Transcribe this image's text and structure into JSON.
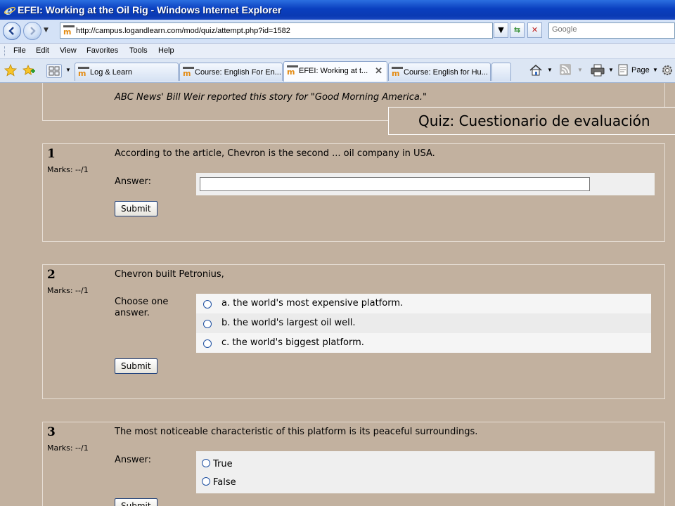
{
  "window": {
    "title": "EFEI: Working at the Oil Rig - Windows Internet Explorer"
  },
  "address": {
    "url": "http://campus.logandlearn.com/mod/quiz/attempt.php?id=1582",
    "search_placeholder": "Google"
  },
  "menu": [
    "File",
    "Edit",
    "View",
    "Favorites",
    "Tools",
    "Help"
  ],
  "tabs": [
    {
      "label": "Log & Learn"
    },
    {
      "label": "Course: English For En..."
    },
    {
      "label": "EFEI: Working at t..."
    },
    {
      "label": "Course: English for Hu..."
    }
  ],
  "commands": {
    "page": "Page"
  },
  "page": {
    "credit": "ABC News' Bill Weir reported this story for \"Good Morning America.\"",
    "overlay_title": "Quiz: Cuestionario de evaluación",
    "questions": [
      {
        "number": "1",
        "marks": "Marks: --/1",
        "text": "According to the article, Chevron is the second ... oil company in USA.",
        "answer_label": "Answer:",
        "answer_value": "",
        "submit": "Submit"
      },
      {
        "number": "2",
        "marks": "Marks: --/1",
        "text": "Chevron built Petronius,",
        "answer_label_1": "Choose one",
        "answer_label_2": "answer.",
        "options": [
          "a. the world's most expensive platform.",
          "b. the world's largest oil well.",
          "c. the world's biggest platform."
        ],
        "submit": "Submit"
      },
      {
        "number": "3",
        "marks": "Marks: --/1",
        "text": "The most noticeable characteristic of this platform is its peaceful surroundings.",
        "answer_label": "Answer:",
        "options": [
          "True",
          "False"
        ],
        "submit": "Submit"
      }
    ]
  }
}
